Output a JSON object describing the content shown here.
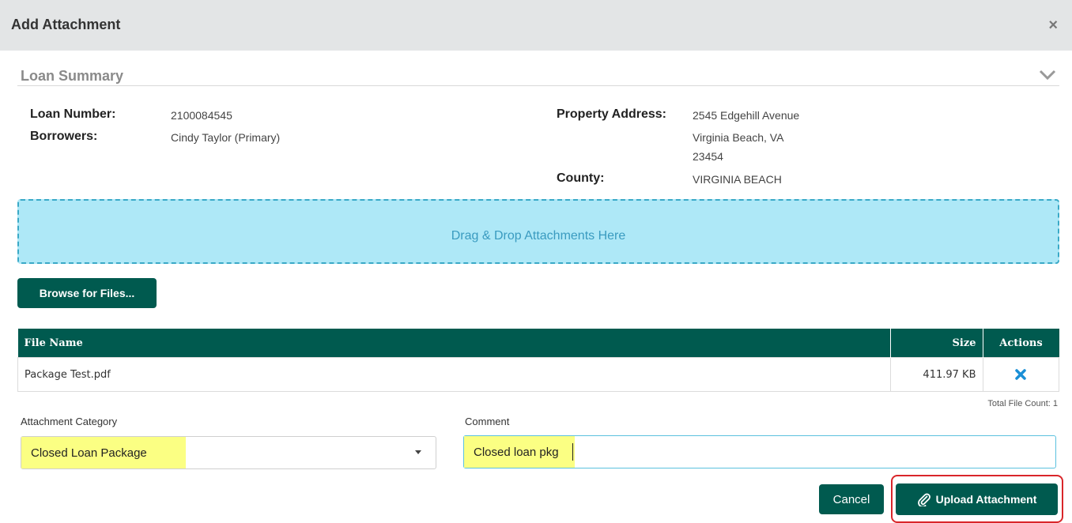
{
  "modal": {
    "title": "Add Attachment",
    "close_label": "×"
  },
  "loan_summary": {
    "title": "Loan Summary",
    "loan_number_label": "Loan Number:",
    "loan_number": "2100084545",
    "borrowers_label": "Borrowers:",
    "borrowers": "Cindy Taylor (Primary)",
    "property_address_label": "Property Address:",
    "address_line1": "2545 Edgehill Avenue",
    "address_line2": "Virginia Beach, VA",
    "address_line3": "23454",
    "county_label": "County:",
    "county": "VIRGINIA BEACH"
  },
  "dropzone": {
    "text": "Drag & Drop Attachments Here"
  },
  "browse_button": "Browse for Files...",
  "file_table": {
    "columns": [
      "File Name",
      "Size",
      "Actions"
    ],
    "rows": [
      {
        "file_name": "Package Test.pdf",
        "size": "411.97 KB",
        "action_icon": "remove-x-icon"
      }
    ],
    "total_label": "Total File Count: 1"
  },
  "form": {
    "category_label": "Attachment Category",
    "category_value": "Closed Loan Package",
    "comment_label": "Comment",
    "comment_value": "Closed loan pkg"
  },
  "buttons": {
    "cancel": "Cancel",
    "upload": "Upload Attachment",
    "upload_icon": "paperclip-icon"
  },
  "colors": {
    "primary": "#005a4f",
    "dropzone_bg": "#aee8f7",
    "highlight": "#fbff83",
    "outline": "#d9262a",
    "remove_icon": "#1a8fd6"
  }
}
